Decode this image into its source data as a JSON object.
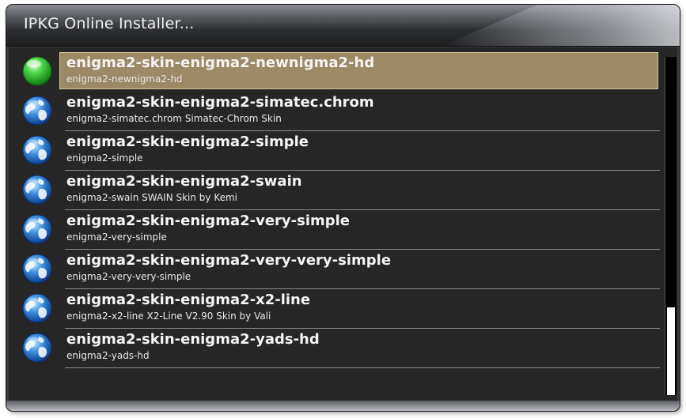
{
  "window": {
    "title": "IPKG Online Installer..."
  },
  "list": {
    "items": [
      {
        "name": "enigma2-skin-enigma2-newnigma2-hd",
        "description": "enigma2-newnigma2-hd",
        "icon": "green-ball-icon",
        "selected": true
      },
      {
        "name": "enigma2-skin-enigma2-simatec.chrom",
        "description": "enigma2-simatec.chrom Simatec-Chrom Skin",
        "icon": "globe-icon",
        "selected": false
      },
      {
        "name": "enigma2-skin-enigma2-simple",
        "description": "enigma2-simple",
        "icon": "globe-icon",
        "selected": false
      },
      {
        "name": "enigma2-skin-enigma2-swain",
        "description": "enigma2-swain SWAIN Skin by Kemi",
        "icon": "globe-icon",
        "selected": false
      },
      {
        "name": "enigma2-skin-enigma2-very-simple",
        "description": "enigma2-very-simple",
        "icon": "globe-icon",
        "selected": false
      },
      {
        "name": "enigma2-skin-enigma2-very-very-simple",
        "description": "enigma2-very-very-simple",
        "icon": "globe-icon",
        "selected": false
      },
      {
        "name": "enigma2-skin-enigma2-x2-line",
        "description": "enigma2-x2-line X2-Line V2.90 Skin by Vali",
        "icon": "globe-icon",
        "selected": false
      },
      {
        "name": "enigma2-skin-enigma2-yads-hd",
        "description": "enigma2-yads-hd",
        "icon": "globe-icon",
        "selected": false
      }
    ]
  },
  "scrollbar": {
    "position_fraction": 0.74,
    "visible_fraction": 0.26
  },
  "colors": {
    "background": "#262626",
    "selection": "#9b8a64",
    "text": "#f4f4f4"
  }
}
